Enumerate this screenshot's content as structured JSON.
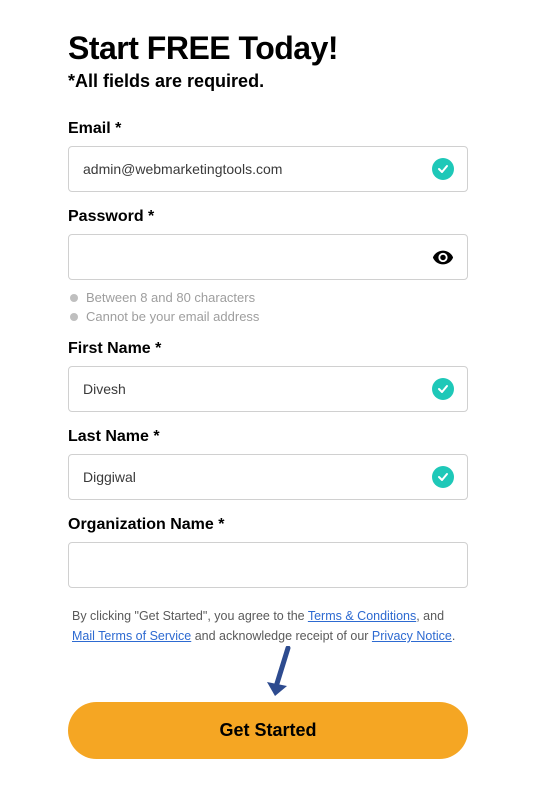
{
  "heading": "Start FREE Today!",
  "subheading": "*All fields are required.",
  "fields": {
    "email": {
      "label": "Email *",
      "value": "admin@webmarketingtools.com",
      "valid": true
    },
    "password": {
      "label": "Password *",
      "value": "",
      "requirements": [
        "Between 8 and 80 characters",
        "Cannot be your email address"
      ]
    },
    "first_name": {
      "label": "First Name *",
      "value": "Divesh",
      "valid": true
    },
    "last_name": {
      "label": "Last Name *",
      "value": "Diggiwal",
      "valid": true
    },
    "organization": {
      "label": "Organization Name *",
      "value": ""
    }
  },
  "legal": {
    "prefix": "By clicking \"Get Started\", you agree to the ",
    "terms_link": "Terms & Conditions",
    "mid1": ", and ",
    "mail_terms_link": "Mail Terms of Service",
    "mid2": " and acknowledge receipt of our ",
    "privacy_link": "Privacy Notice",
    "suffix": "."
  },
  "submit_label": "Get Started"
}
